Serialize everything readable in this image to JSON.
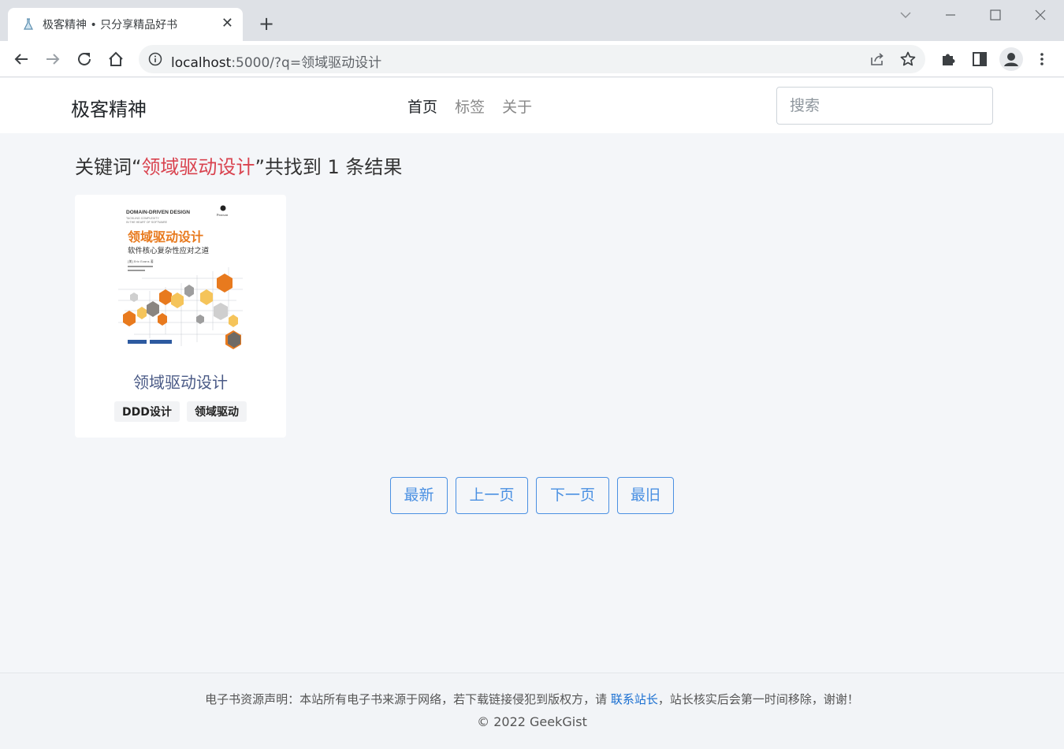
{
  "browser": {
    "tab_title": "极客精神 • 只分享精品好书",
    "tab_close": "✕",
    "new_tab": "+",
    "url_host": "localhost",
    "url_rest": ":5000/?q=领域驱动设计"
  },
  "site": {
    "brand": "极客精神",
    "nav": [
      {
        "label": "首页",
        "active": true
      },
      {
        "label": "标签",
        "active": false
      },
      {
        "label": "关于",
        "active": false
      }
    ],
    "search_placeholder": "搜索"
  },
  "results": {
    "prefix": "关键词“",
    "keyword": "领域驱动设计",
    "middle": "”共找到 ",
    "count": "1",
    "suffix": " 条结果"
  },
  "books": [
    {
      "title": "领域驱动设计",
      "tags": [
        "DDD设计",
        "领域驱动"
      ],
      "cover": {
        "header": "DOMAIN-DRIVEN DESIGN",
        "sub1": "TACKLING COMPLEXITY",
        "sub2": "IN THE HEART OF SOFTWARE",
        "publisher": "Pearson",
        "cn_title": "领域驱动设计",
        "cn_subtitle": "软件核心复杂性应对之道",
        "author": "[美] Eric Evans 著"
      }
    }
  ],
  "pagination": {
    "newest": "最新",
    "prev": "上一页",
    "next": "下一页",
    "oldest": "最旧"
  },
  "footer": {
    "disclaimer_before": "电子书资源声明：本站所有电子书来源于网络，若下载链接侵犯到版权方，请 ",
    "contact_link": "联系站长",
    "disclaimer_after": "，站长核实后会第一时间移除，谢谢！",
    "copyright": "© 2022 GeekGist"
  },
  "colors": {
    "keyword": "#d9434f",
    "link": "#1a6fd1",
    "pager": "#4a90e2",
    "cover_orange": "#e87a1e"
  }
}
